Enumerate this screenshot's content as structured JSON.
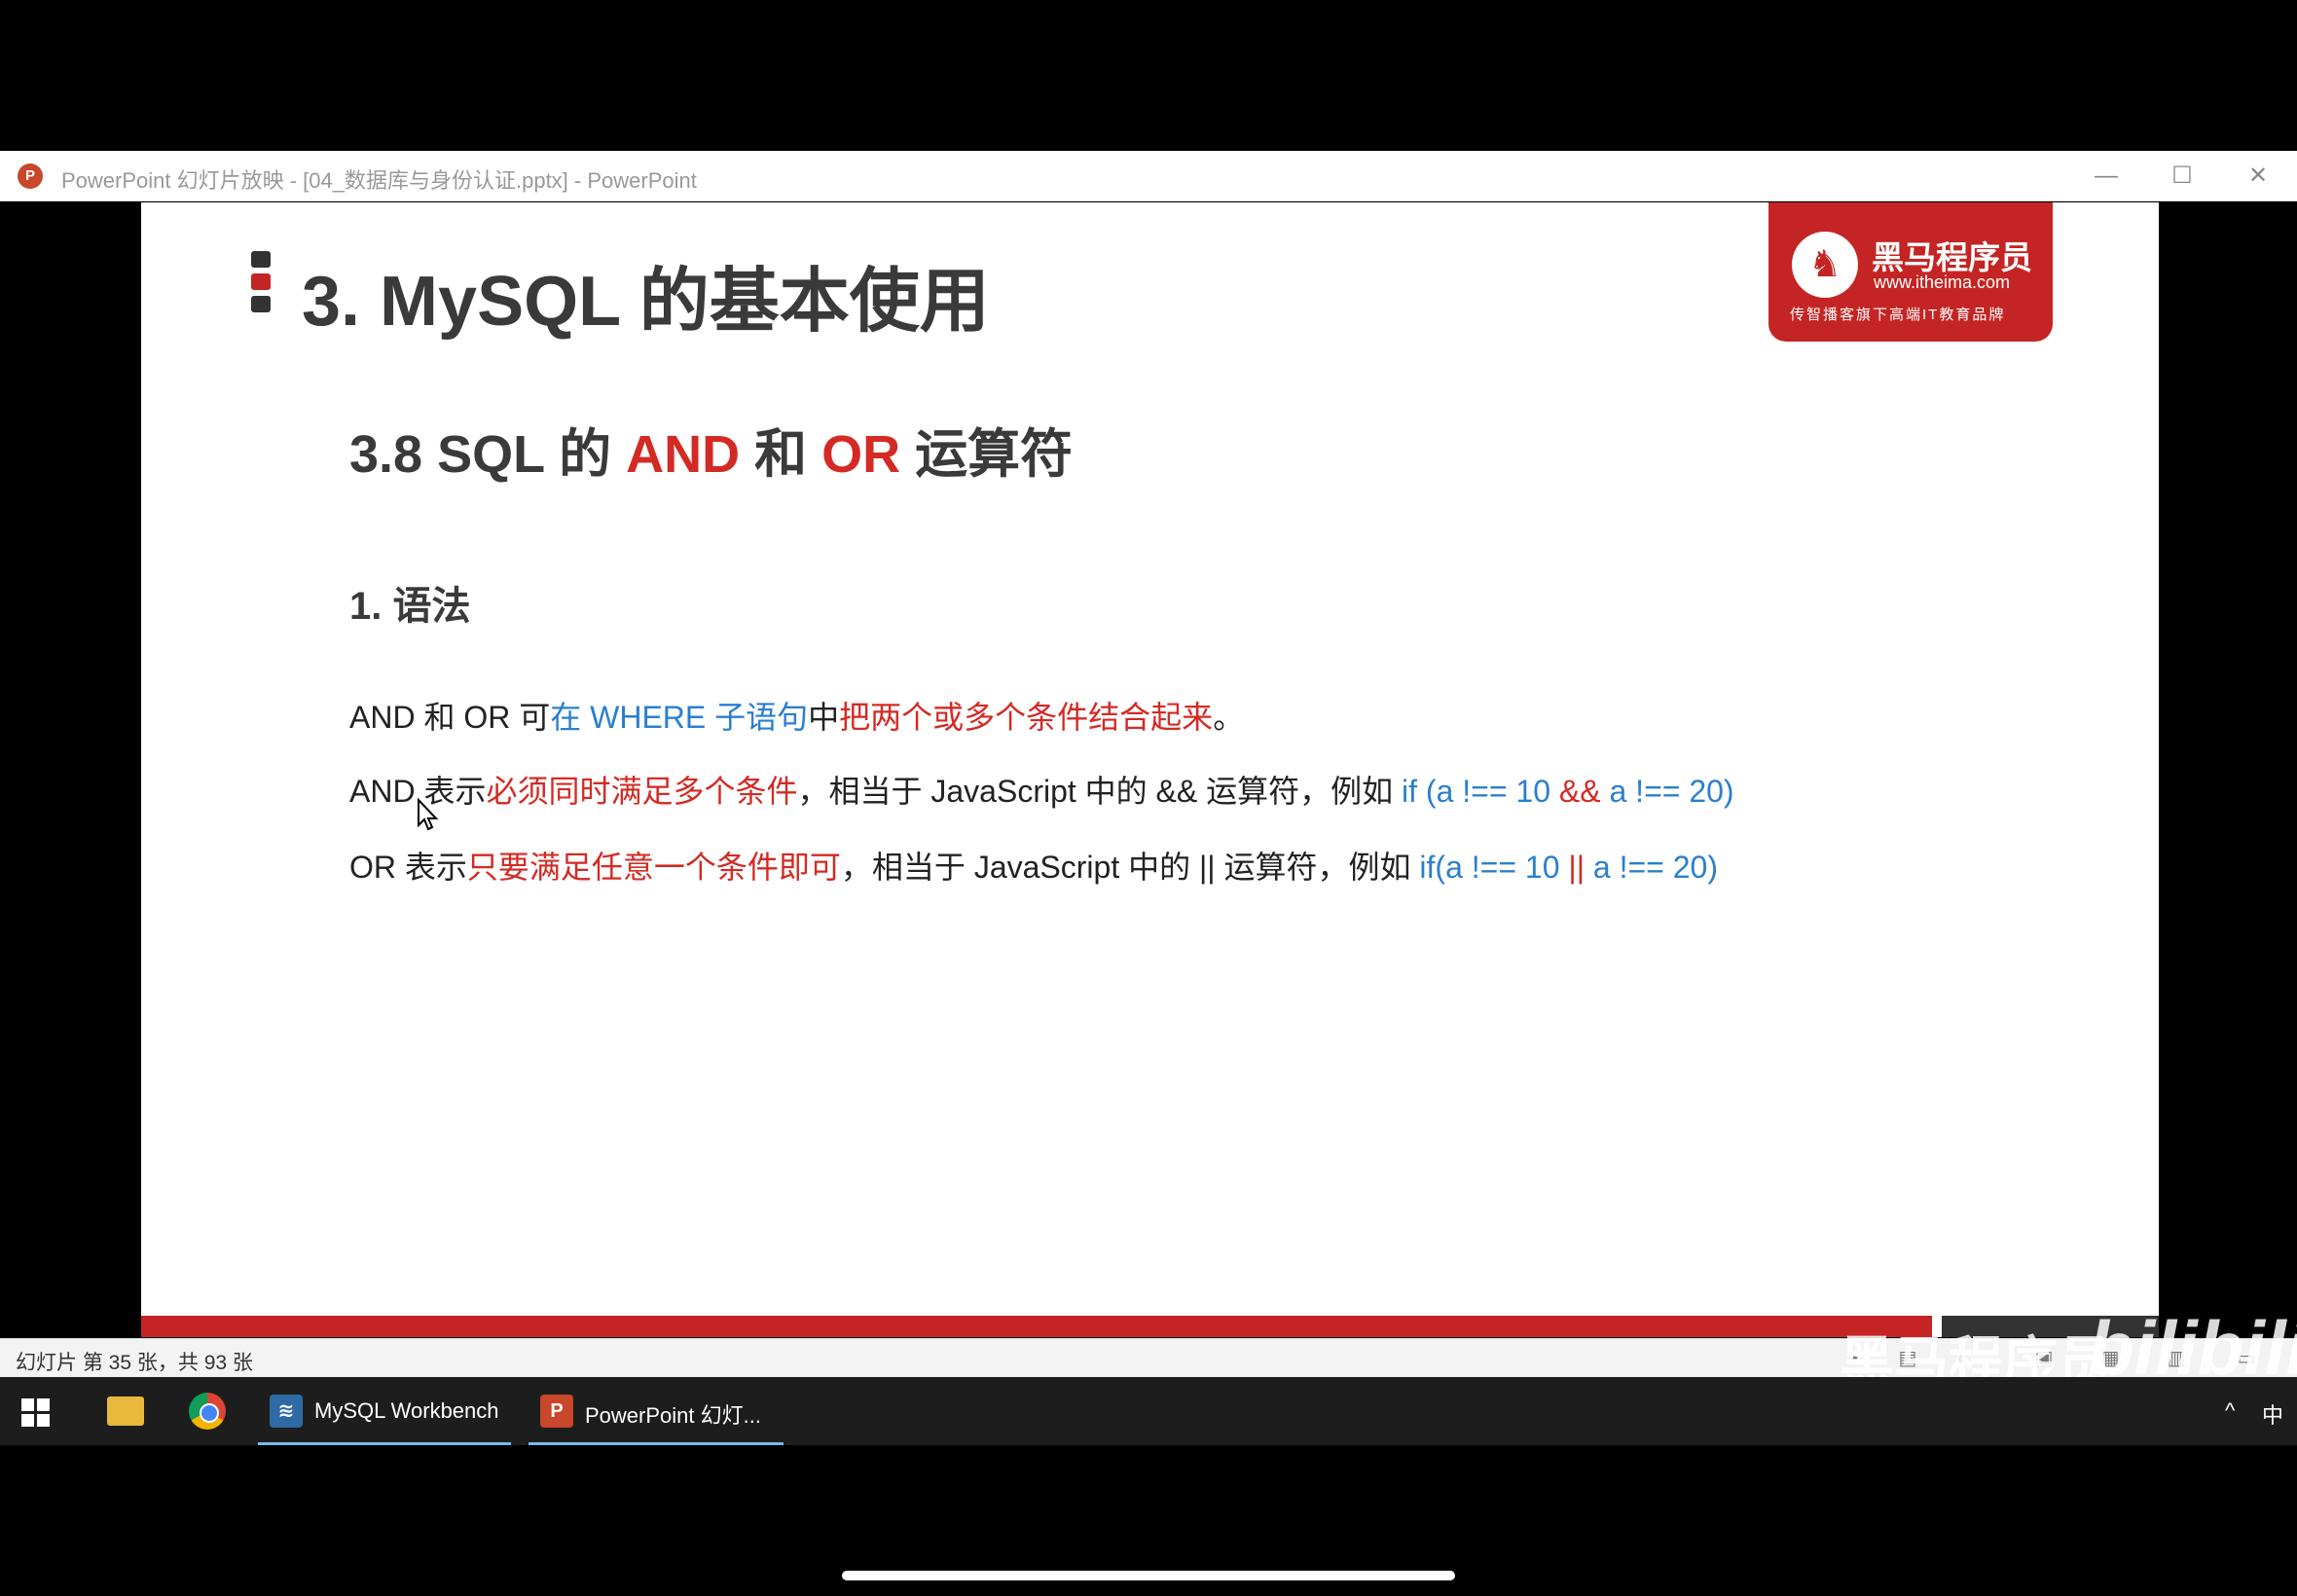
{
  "window": {
    "title": "PowerPoint 幻灯片放映 - [04_数据库与身份认证.pptx] - PowerPoint",
    "app_icon": "P",
    "minimize": "—",
    "maximize": "☐",
    "close": "✕"
  },
  "slide": {
    "title": "3. MySQL 的基本使用",
    "logo": {
      "name": "黑马程序员",
      "url": "www.itheima.com",
      "slogan": "传智播客旗下高端IT教育品牌"
    },
    "subtitle": {
      "prefix": "3.8 SQL 的 ",
      "and": "AND",
      "mid": " 和 ",
      "or": "OR",
      "suffix": " 运算符"
    },
    "section": "1. 语法",
    "line1": {
      "a": "AND 和 OR 可",
      "b": "在 WHERE 子语句",
      "c": "中",
      "d": "把两个或多个条件结合起来",
      "e": "。"
    },
    "line2": {
      "a": "AND 表示",
      "b": "必须同时满足多个条件",
      "c": "，相当于 JavaScript 中的 && 运算符，例如 ",
      "d": "if (a !== 10 ",
      "e": "&&",
      "f": " a !== 20)"
    },
    "line3": {
      "a": "OR 表示",
      "b": "只要满足任意一个条件即可",
      "c": "，相当于 JavaScript 中的 || 运算符，例如 ",
      "d": "if(a !== 10 ",
      "e": "||",
      "f": " a !== 20)"
    }
  },
  "statusbar": {
    "slide_counter": "幻灯片 第 35 张，共 93 张"
  },
  "watermark": {
    "text": "黑马程序员",
    "brand": "bilibili"
  },
  "taskbar": {
    "apps": [
      {
        "label": "MySQL Workbench",
        "icon": "mysql-workbench-icon"
      },
      {
        "label": "PowerPoint 幻灯...",
        "icon": "powerpoint-icon"
      }
    ],
    "tray_up": "^",
    "ime": "中"
  }
}
